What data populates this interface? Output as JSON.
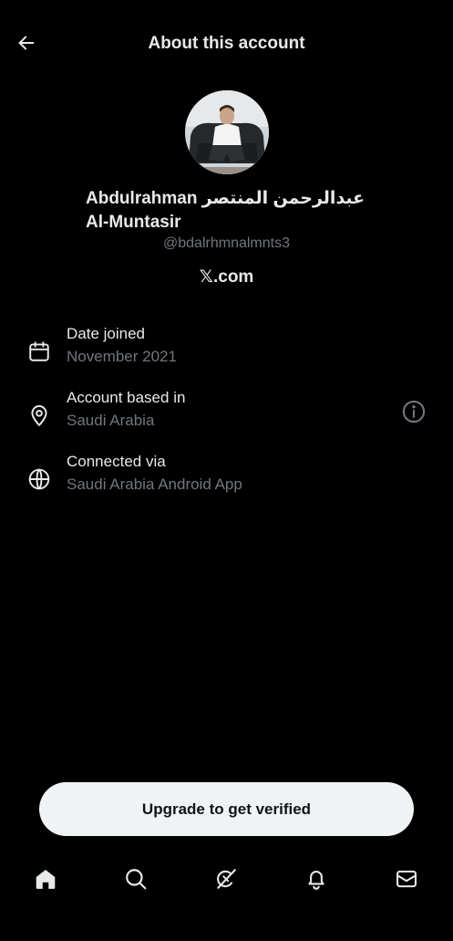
{
  "header": {
    "title": "About this account",
    "back_icon": "arrow-left-icon"
  },
  "profile": {
    "name": "Abdulrahman عبدالرحمن المنتصر Al-Muntasir",
    "handle": "@bdalrhmnalmnts3",
    "source_site": "𝕏.com"
  },
  "details": [
    {
      "icon": "calendar-icon",
      "label": "Date joined",
      "value": "November 2021"
    },
    {
      "icon": "location-pin-icon",
      "label": "Account based in",
      "value": "Saudi Arabia"
    },
    {
      "icon": "globe-icon",
      "label": "Connected via",
      "value": "Saudi Arabia Android App"
    }
  ],
  "upgrade_button": "Upgrade to get verified",
  "nav": [
    {
      "name": "home-icon"
    },
    {
      "name": "search-icon"
    },
    {
      "name": "grok-icon"
    },
    {
      "name": "notifications-icon"
    },
    {
      "name": "messages-icon"
    }
  ],
  "colors": {
    "background": "#000000",
    "text_primary": "#e7e9ea",
    "text_secondary": "#71767b",
    "button_bg": "#eff3f4"
  }
}
